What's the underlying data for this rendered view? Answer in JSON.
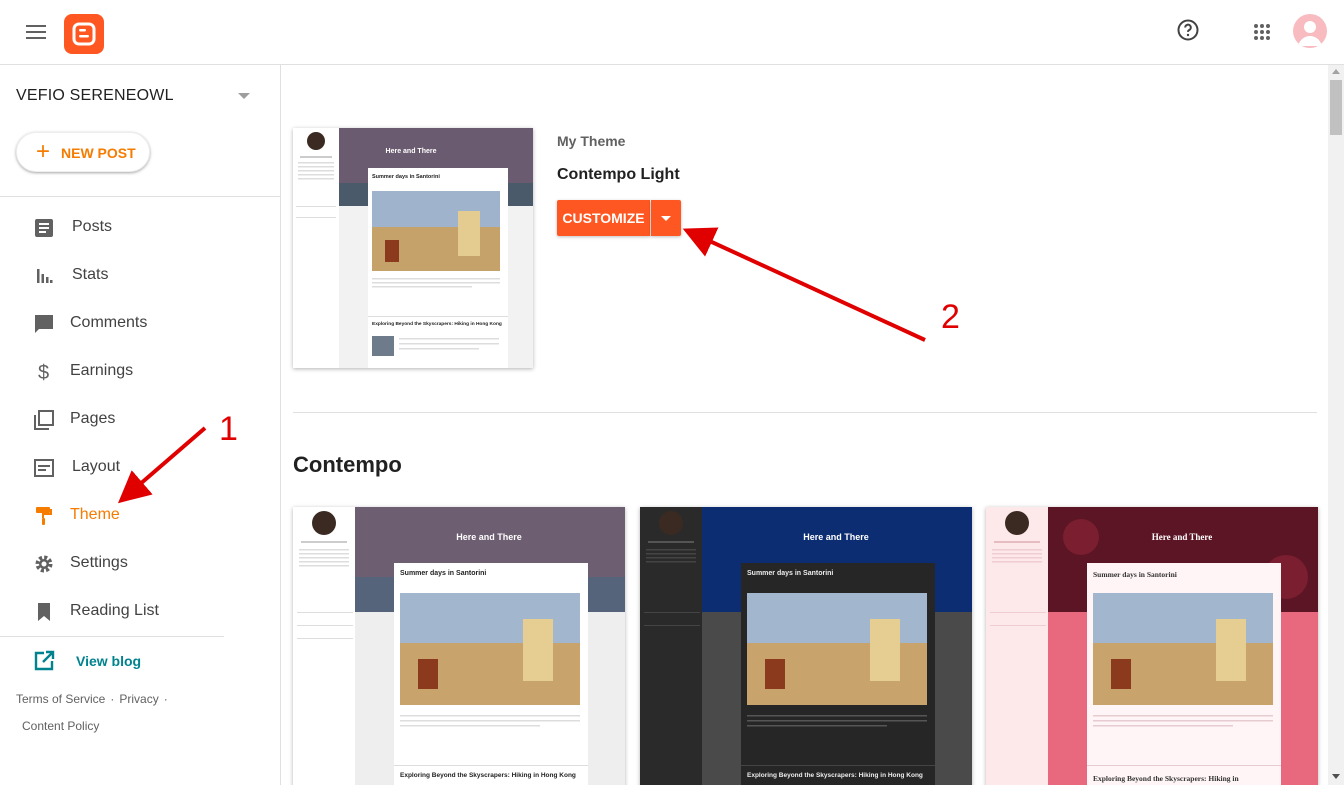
{
  "app": {
    "brand_color": "#ff5722",
    "accent": "#f57c00",
    "link_color": "#00838f"
  },
  "header": {
    "menu_icon": "hamburger-icon",
    "logo": "blogger-logo",
    "help_icon": "help-circle-icon",
    "apps_icon": "apps-grid-icon",
    "avatar": "user-avatar"
  },
  "sidebar": {
    "blog_name": "VEFIO SERENEOWL",
    "new_post_label": "NEW POST",
    "items": [
      {
        "label": "Posts",
        "icon": "posts-icon"
      },
      {
        "label": "Stats",
        "icon": "stats-icon"
      },
      {
        "label": "Comments",
        "icon": "comments-icon"
      },
      {
        "label": "Earnings",
        "icon": "dollar-icon"
      },
      {
        "label": "Pages",
        "icon": "pages-icon"
      },
      {
        "label": "Layout",
        "icon": "layout-icon"
      },
      {
        "label": "Theme",
        "icon": "paint-roller-icon",
        "active": true
      },
      {
        "label": "Settings",
        "icon": "gear-icon"
      },
      {
        "label": "Reading List",
        "icon": "bookmark-icon"
      }
    ],
    "view_blog": "View blog",
    "footer": {
      "terms": "Terms of Service",
      "privacy": "Privacy",
      "content_policy": "Content Policy"
    }
  },
  "main": {
    "my_theme_label": "My Theme",
    "theme_name": "Contempo Light",
    "customize_label": "CUSTOMIZE",
    "section_title": "Contempo"
  },
  "preview": {
    "blog_title": "Here and There",
    "post1_title": "Summer days in Santorini",
    "post2_title": "Exploring Beyond the Skyscrapers: Hiking in Hong Kong",
    "post2_title_short": "Exploring Beyond the Skyscrapers: Hiking in"
  },
  "annotations": {
    "one": "1",
    "two": "2",
    "color": "#e00000"
  }
}
